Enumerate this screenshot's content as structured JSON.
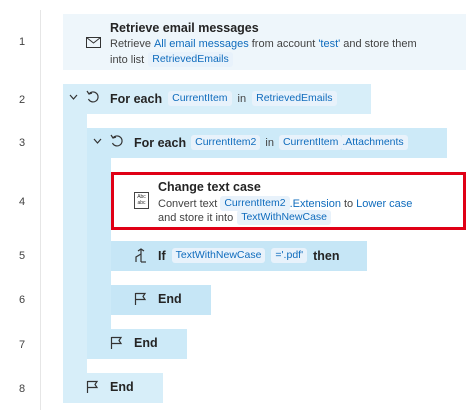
{
  "line_numbers": [
    "1",
    "2",
    "3",
    "4",
    "5",
    "6",
    "7",
    "8"
  ],
  "step1": {
    "title": "Retrieve email messages",
    "text1": "Retrieve",
    "link1": "All email messages",
    "text2": "from account",
    "account": "'test'",
    "text3": "and store them",
    "text4": "into list",
    "var": "RetrievedEmails",
    "icon": "mail-icon"
  },
  "step2": {
    "keyword": "For each",
    "var1": "CurrentItem",
    "in": "in",
    "var2": "RetrievedEmails",
    "icon": "loop-icon"
  },
  "step3": {
    "keyword": "For each",
    "var1": "CurrentItem2",
    "in": "in",
    "var2": "CurrentItem",
    "suffix": ".Attachments",
    "icon": "loop-icon"
  },
  "step4": {
    "title": "Change text case",
    "text1": "Convert text",
    "var1": "CurrentItem2",
    "suffix": ".Extension",
    "to": "to",
    "link1": "Lower case",
    "text2": "and store it into",
    "var2": "TextWithNewCase",
    "icon": "text-case-icon",
    "icon_text": "Abc abc",
    "highlight_color": "#e00016"
  },
  "step5": {
    "keyword": "If",
    "var1": "TextWithNewCase",
    "cond": "='.pdf'",
    "then": "then",
    "icon": "if-branch-icon"
  },
  "step6": {
    "keyword": "End",
    "icon": "flag-icon"
  },
  "step7": {
    "keyword": "End",
    "icon": "flag-icon"
  },
  "step8": {
    "keyword": "End",
    "icon": "flag-icon"
  }
}
